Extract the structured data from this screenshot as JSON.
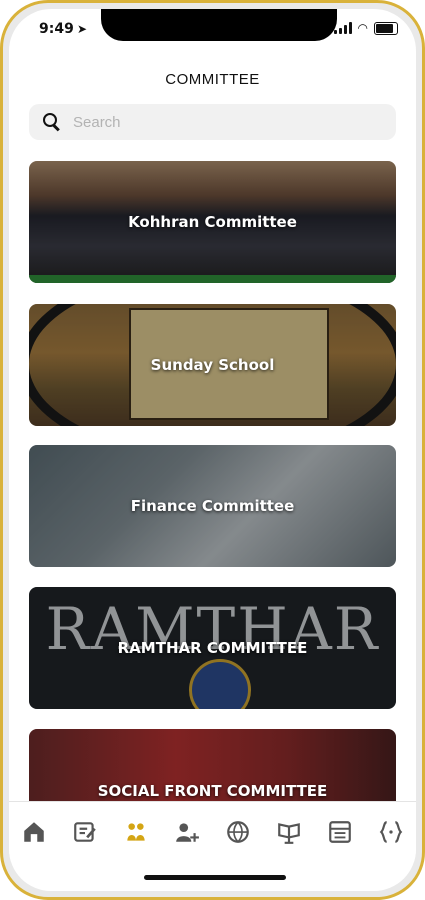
{
  "status": {
    "time": "9:49"
  },
  "header": {
    "title": "COMMITTEE"
  },
  "search": {
    "placeholder": "Search"
  },
  "committees": [
    {
      "label": "Kohhran Committee"
    },
    {
      "label": "Sunday School"
    },
    {
      "label": "Finance Committee"
    },
    {
      "label": "RAMTHAR COMMITTEE",
      "banner_text": "RAMTHAR"
    },
    {
      "label": "SOCIAL FRONT COMMITTEE"
    }
  ],
  "tabbar": {
    "items": [
      {
        "icon": "home-icon",
        "active": false
      },
      {
        "icon": "edit-note-icon",
        "active": false
      },
      {
        "icon": "committee-icon",
        "active": true
      },
      {
        "icon": "add-user-icon",
        "active": false
      },
      {
        "icon": "globe-network-icon",
        "active": false
      },
      {
        "icon": "book-stand-icon",
        "active": false
      },
      {
        "icon": "calendar-table-icon",
        "active": false
      },
      {
        "icon": "braces-icon",
        "active": false
      }
    ],
    "active_color": "#d4a514",
    "inactive_color": "#555555"
  }
}
